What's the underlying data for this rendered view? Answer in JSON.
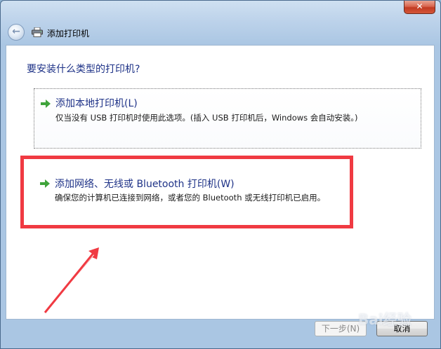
{
  "window": {
    "title": "添加打印机",
    "close_label": "✕"
  },
  "content": {
    "question": "要安装什么类型的打印机?",
    "options": [
      {
        "title": "添加本地打印机(L)",
        "description": "仅当没有 USB 打印机时使用此选项。(插入 USB 打印机后，Windows 会自动安装。)"
      },
      {
        "title": "添加网络、无线或 Bluetooth 打印机(W)",
        "description": "确保您的计算机已连接到网络，或者您的 Bluetooth 或无线打印机已启用。"
      }
    ]
  },
  "footer": {
    "next_label": "下一步(N)",
    "cancel_label": "取消"
  },
  "colors": {
    "highlight": "#f03a42",
    "title_text": "#1e3287",
    "arrow_green": "#3fa43b"
  },
  "watermark": "Bai经验",
  "icons": [
    "back-arrow-icon",
    "printer-icon",
    "green-arrow-icon",
    "close-icon"
  ]
}
